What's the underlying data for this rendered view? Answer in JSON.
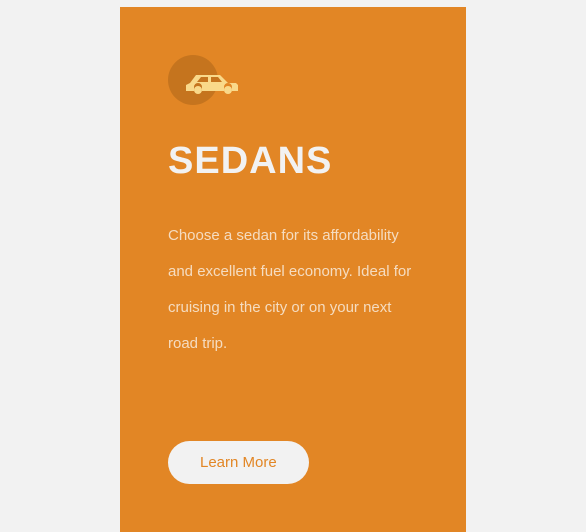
{
  "card": {
    "title": "SEDANS",
    "description": "Choose a sedan for its affordability and excellent fuel economy. Ideal for cruising in the city or on your next road trip.",
    "cta_label": "Learn More"
  }
}
